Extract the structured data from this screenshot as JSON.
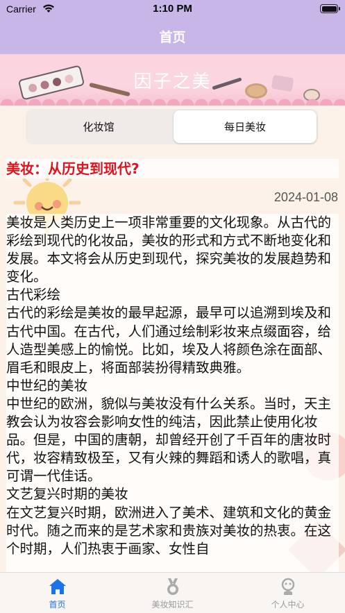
{
  "status_bar": {
    "carrier": "Carrier",
    "time": "1:10 PM"
  },
  "nav": {
    "title": "首页"
  },
  "banner": {
    "title": "因子之美"
  },
  "segment": {
    "items": [
      "化妆馆",
      "每日美妆"
    ],
    "selected": "每日美妆"
  },
  "article": {
    "title": "美妆：从历史到现代?",
    "date": "2024-01-08",
    "body": "美妆是人类历史上一项非常重要的文化现象。从古代的彩绘到现代的化妆品，美妆的形式和方式不断地变化和发展。本文将会从历史到现代，探究美妆的发展趋势和变化。\n古代彩绘\n古代的彩绘是美妆的最早起源，最早可以追溯到埃及和古代中国。在古代，人们通过绘制彩妆来点缀面容，给人造型美感上的愉悦。比如，埃及人将颜色涂在面部、眉毛和眼皮上，将面部装扮得精致典雅。\n中世纪的美妆\n中世纪的欧洲，貌似与美妆没有什么关系。当时，天主教会认为妆容会影响女性的纯洁，因此禁止使用化妆品。但是，中国的唐朝，却曾经开创了千百年的唐妆时代，妆容精致极至，又有火辣的舞蹈和诱人的歌唱，真可谓一代佳话。\n文艺复兴时期的美妆\n在文艺复兴时期，欧洲进入了美术、建筑和文化的黄金时代。随之而来的是艺术家和贵族对美妆的热衷。在这个时期，人们热衷于画家、女性自"
  },
  "tabs": [
    {
      "label": "首页",
      "icon": "home-icon",
      "active": true
    },
    {
      "label": "美妆知识汇",
      "icon": "medal-icon",
      "active": false
    },
    {
      "label": "个人中心",
      "icon": "person-icon",
      "active": false
    }
  ],
  "colors": {
    "nav_bg": "#c8b6e8",
    "title_red": "#e1121b",
    "tab_active": "#1a73e8",
    "tab_inactive": "#999999"
  }
}
